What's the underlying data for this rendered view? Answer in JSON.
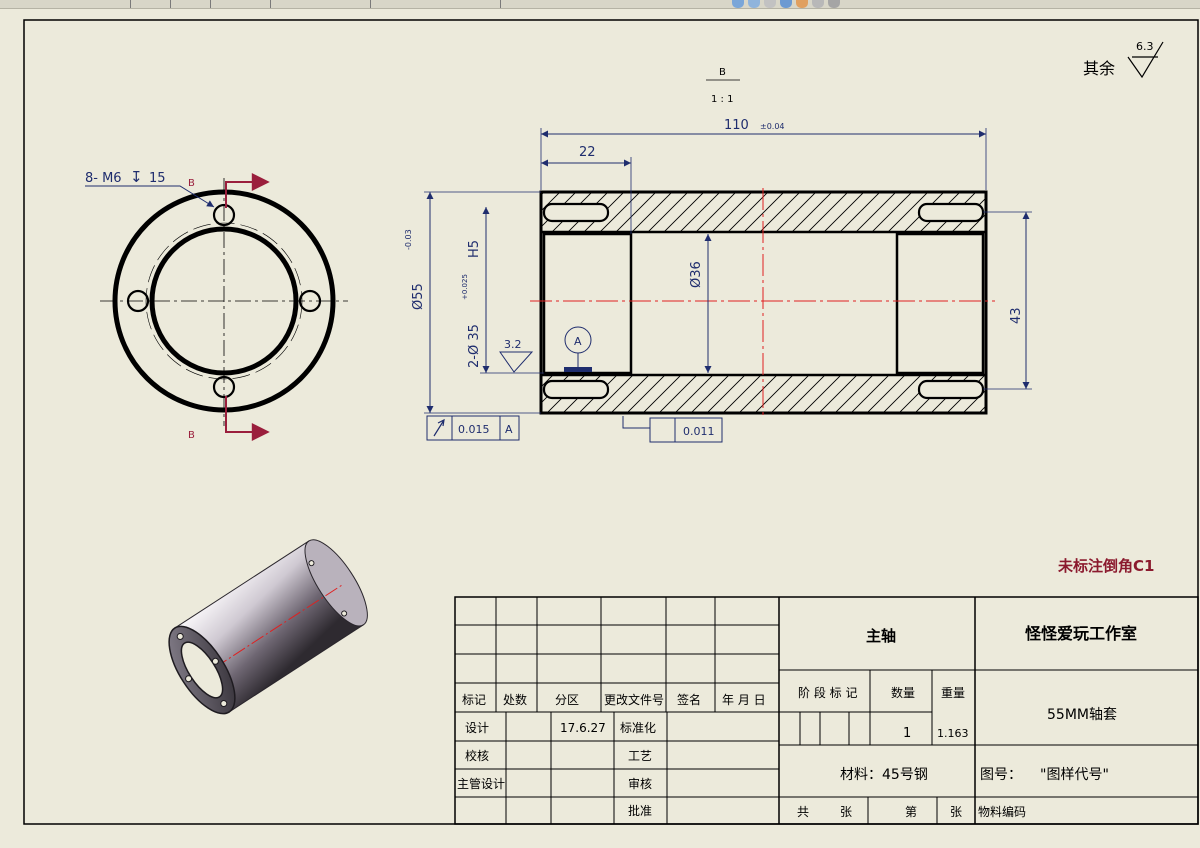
{
  "notes": {
    "surface_finish_rest": "其余",
    "surface_finish_value": "6.3",
    "chamfer_note": "未标注倒角C1"
  },
  "views": {
    "section_label": "B",
    "section_scale": "1 : 1",
    "cut_mark_top": "B",
    "cut_mark_bottom": "B"
  },
  "dimensions": {
    "overall_length": "110",
    "overall_length_tol": "±0.04",
    "counterbore_depth": "22",
    "outer_diameter": "Ø55",
    "outer_diameter_tol": "-0.03",
    "bore_spec": "2-Ø 35",
    "bore_tol": "+0.025",
    "bore_fit": "H5",
    "inner_diameter": "Ø36",
    "hole_spacing": "43",
    "thread_holes": "8- M6",
    "thread_depth_symbol": "↧",
    "thread_depth": "15",
    "bore_roughness": "3.2"
  },
  "tolerances": {
    "runout_value": "0.015",
    "runout_datum": "A",
    "datum_label": "A",
    "flatness_value": "0.011"
  },
  "title_block": {
    "part_name": "主轴",
    "company": "怪怪爱玩工作室",
    "drawing_title": "55MM轴套",
    "material": "材料：45号钢",
    "drawing_no_label": "图号：",
    "drawing_no_value": "\"图样代号\"",
    "headers": {
      "mark": "标记",
      "count": "处数",
      "zone": "分区",
      "change_doc": "更改文件号",
      "signature": "签名",
      "date": "年 月 日",
      "stage_mark": "阶 段 标 记",
      "quantity": "数量",
      "weight": "重量"
    },
    "quantity_value": "1",
    "weight_value": "1.163",
    "rows": {
      "design": "设计",
      "design_date": "17.6.27",
      "standardize": "标准化",
      "check": "校核",
      "process": "工艺",
      "chief_design": "主管设计",
      "review": "审核",
      "approve": "批准"
    },
    "sheet_total_a": "共",
    "sheet_total_b": "张",
    "sheet_no_a": "第",
    "sheet_no_b": "张",
    "material_code": "物料编码"
  },
  "colors": {
    "background": "#eceadb",
    "outline": "#000000",
    "dimension": "#1f2d6e",
    "centerline": "#e02020",
    "cut_arrow": "#9a1e3c",
    "note": "#8b1a2e"
  }
}
